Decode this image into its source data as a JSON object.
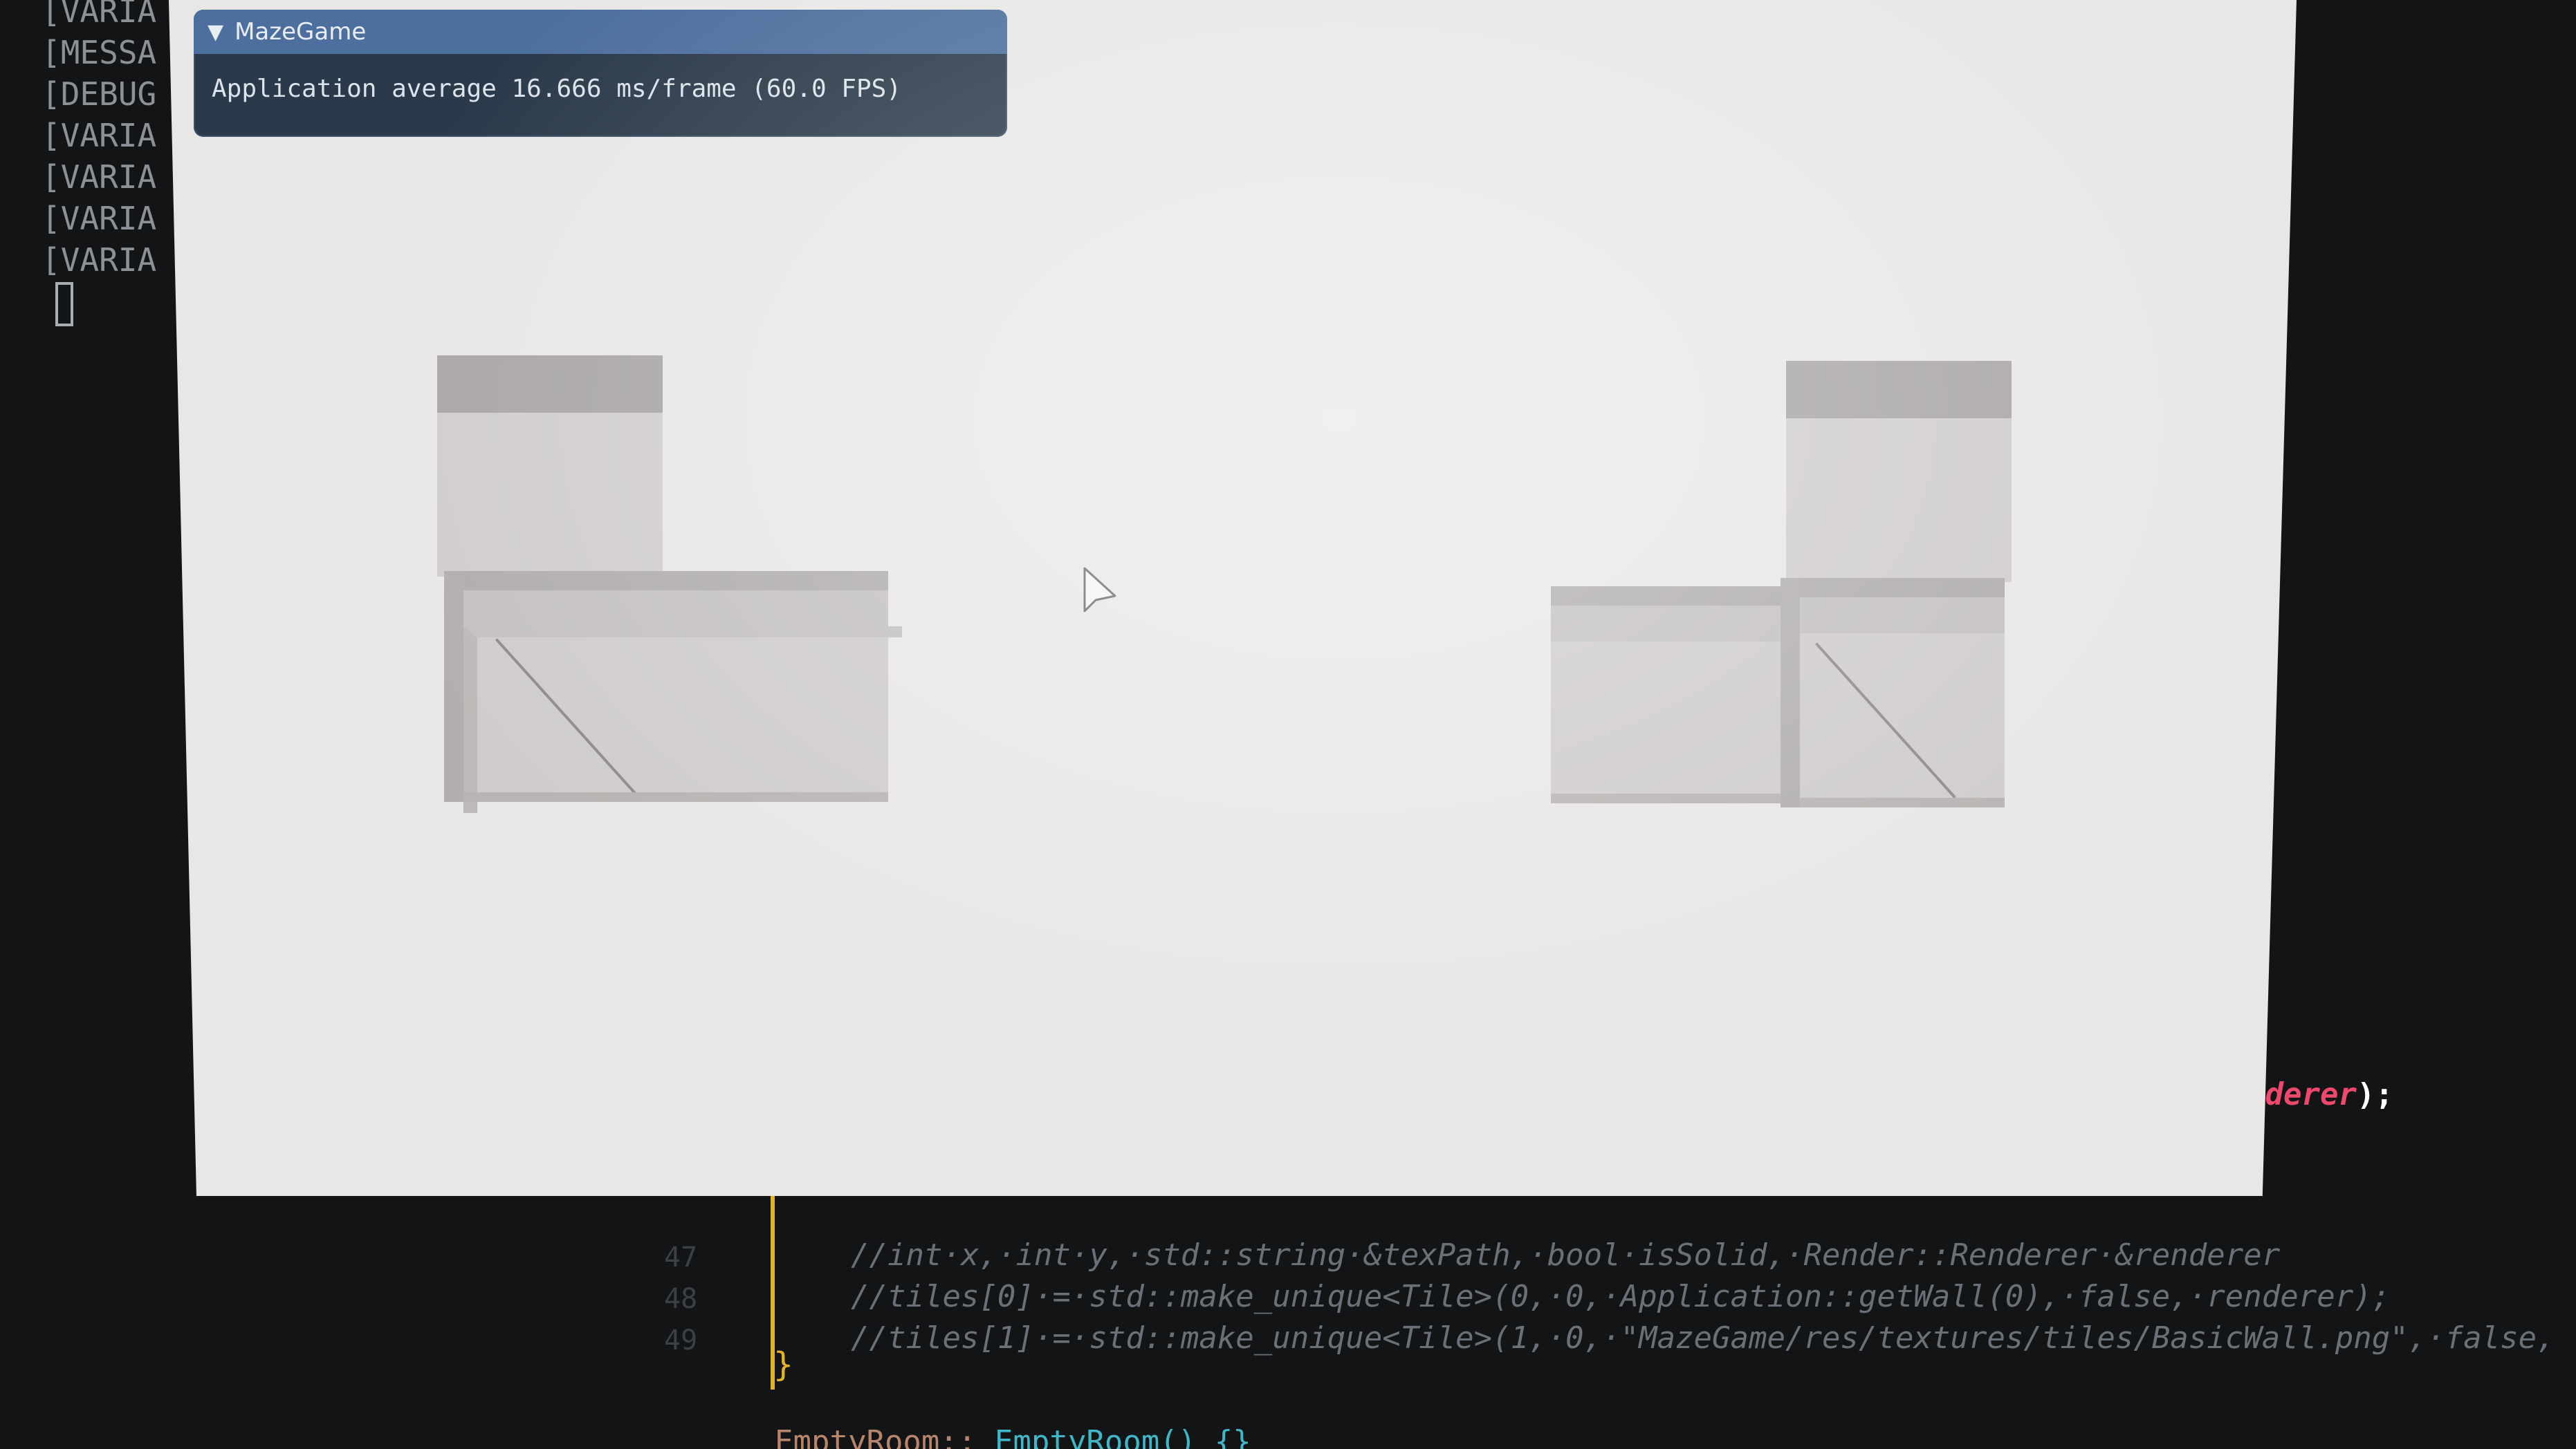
{
  "terminal": {
    "lines": [
      "[VARIA",
      "[MESSA",
      "[DEBUG",
      "[VARIA",
      "[VARIA",
      "[VARIA",
      "[VARIA"
    ]
  },
  "imgui": {
    "title": "MazeGame",
    "collapse_icon": "triangle-down-icon",
    "stats_text": "Application average 16.666 ms/frame (60.0 FPS)"
  },
  "editor": {
    "line_numbers": [
      "47",
      "48",
      "49"
    ],
    "code_lines": [
      "//int·x,·int·y,·std::string·&texPath,·bool·isSolid,·Render::Renderer·&renderer",
      "//tiles[0]·=·std::make_unique<Tile>(0,·0,·Application::getWall(0),·false,·renderer);",
      "//tiles[1]·=·std::make_unique<Tile>(1,·0,·\"MazeGame/res/textures/tiles/BasicWall.png\",·false,"
    ],
    "closing_brace": "}",
    "bottom_line_class": "EmptyRoom::",
    "bottom_line_fn": "EmptyRoom() {}",
    "side_fragment": "nderer",
    "side_fragment_punct": ");"
  },
  "colors": {
    "accent_title": "#4d6f9e",
    "panel_bg": "#2b3a4a",
    "scene_bg": "#e9e7e6",
    "highlight_pink": "#f0486d",
    "gutter_yellow": "#e2b22c"
  }
}
